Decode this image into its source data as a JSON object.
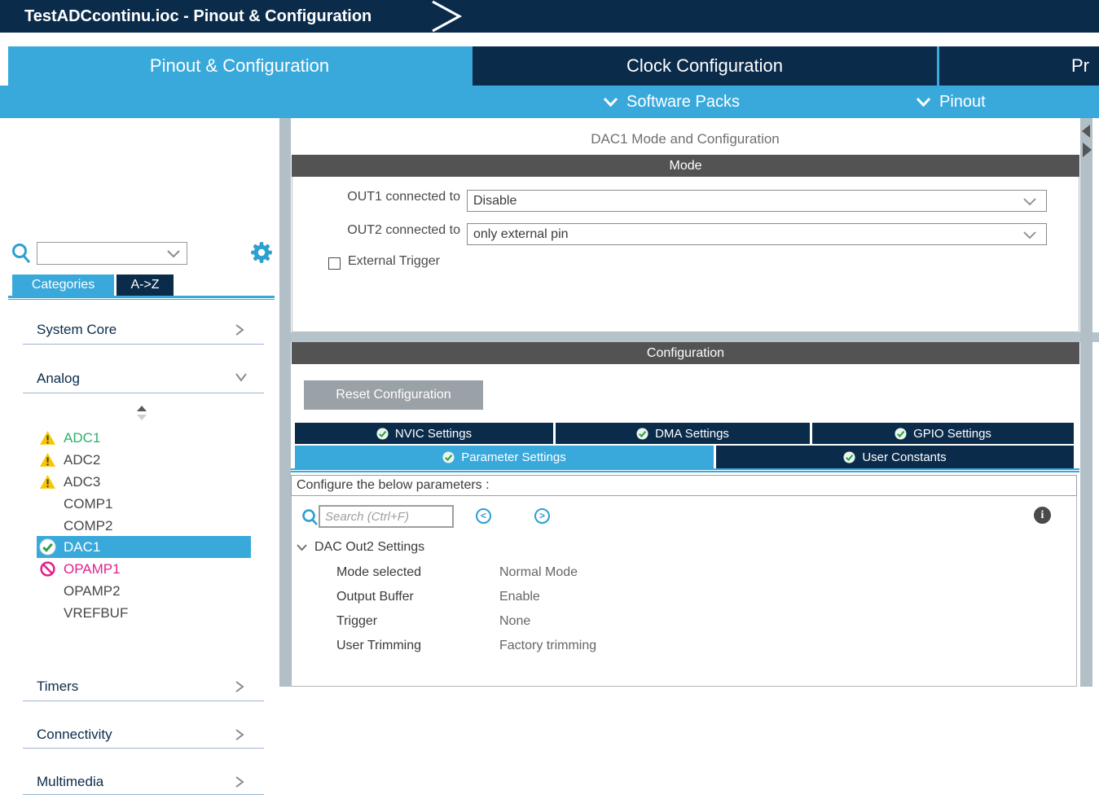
{
  "title_bar": {
    "title": "TestADCcontinu.ioc - Pinout & Configuration"
  },
  "tabs": {
    "pinout_config": "Pinout & Configuration",
    "clock_config": "Clock Configuration",
    "project_manager_partial": "Pr"
  },
  "subbar": {
    "software_packs": "Software Packs",
    "pinout": "Pinout"
  },
  "sidebar": {
    "search_value": "",
    "tab_categories": "Categories",
    "tab_az": "A->Z",
    "cat_system_core": "System Core",
    "cat_analog": "Analog",
    "cat_timers": "Timers",
    "cat_connectivity": "Connectivity",
    "cat_multimedia": "Multimedia",
    "analog_items": [
      {
        "label": "ADC1",
        "icon": "warning"
      },
      {
        "label": "ADC2",
        "icon": "warning"
      },
      {
        "label": "ADC3",
        "icon": "warning"
      },
      {
        "label": "COMP1",
        "icon": "none"
      },
      {
        "label": "COMP2",
        "icon": "none"
      },
      {
        "label": "DAC1",
        "icon": "check",
        "selected": true
      },
      {
        "label": "OPAMP1",
        "icon": "blocked"
      },
      {
        "label": "OPAMP2",
        "icon": "none"
      },
      {
        "label": "VREFBUF",
        "icon": "none"
      }
    ]
  },
  "main": {
    "panel_title": "DAC1 Mode and Configuration",
    "mode_header": "Mode",
    "out1_label": "OUT1 connected to",
    "out1_value": "Disable",
    "out2_label": "OUT2 connected to",
    "out2_value": "only external pin",
    "external_trigger_label": "External Trigger",
    "config_header": "Configuration",
    "reset_button": "Reset Configuration",
    "settings_tabs": {
      "nvic": "NVIC Settings",
      "dma": "DMA Settings",
      "gpio": "GPIO Settings",
      "parameter": "Parameter Settings",
      "user_constants": "User Constants"
    },
    "configure_label": "Configure the below parameters :",
    "search_placeholder": "Search (Ctrl+F)",
    "prev_symbol": "<",
    "next_symbol": ">",
    "info_symbol": "i",
    "tree": {
      "group": "DAC Out2 Settings",
      "rows": [
        {
          "name": "Mode selected",
          "value": "Normal Mode"
        },
        {
          "name": "Output Buffer",
          "value": "Enable"
        },
        {
          "name": "Trigger",
          "value": "None"
        },
        {
          "name": "User Trimming",
          "value": "Factory trimming"
        }
      ]
    }
  },
  "colors": {
    "accent_blue": "#39a9dc",
    "navy": "#0b2b4b",
    "bar_gray": "#535353",
    "splitter_gray": "#b5c3ca",
    "check_green": "#2f9e44",
    "warning_yellow": "#f6c700",
    "blocked_pink": "#e0218a",
    "adc_green_text": "#2eaf6e"
  }
}
